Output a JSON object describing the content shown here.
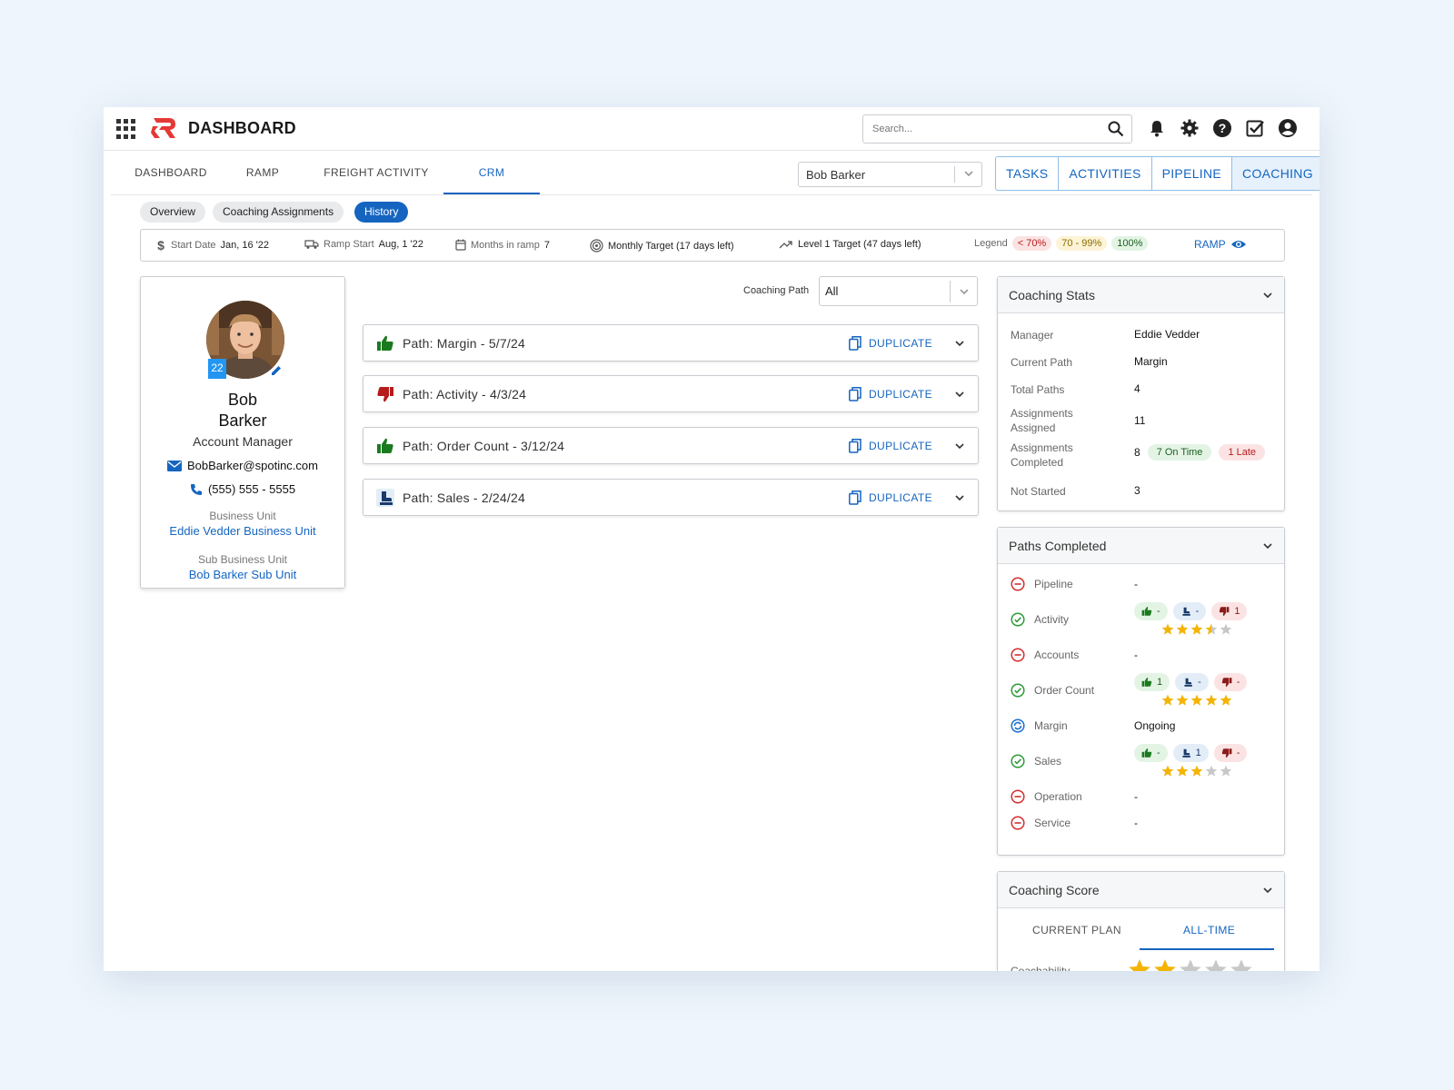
{
  "app": {
    "title": "DASHBOARD",
    "search_placeholder": "Search..."
  },
  "nav": {
    "tabs": [
      "DASHBOARD",
      "RAMP",
      "FREIGHT ACTIVITY",
      "CRM"
    ],
    "active": "CRM",
    "user_select": "Bob Barker",
    "actions": [
      "TASKS",
      "ACTIVITIES",
      "PIPELINE",
      "COACHING"
    ]
  },
  "chips": [
    "Overview",
    "Coaching Assignments",
    "History"
  ],
  "strip": {
    "start_date_label": "Start Date",
    "start_date": "Jan, 16 '22",
    "ramp_start_label": "Ramp Start",
    "ramp_start": "Aug, 1 '22",
    "months_label": "Months in ramp",
    "months": "7",
    "monthly_target": "Monthly Target (17 days left)",
    "level_target": "Level 1 Target (47 days left)",
    "legend_label": "Legend",
    "legend": [
      "< 70%",
      "70 - 99%",
      "100%"
    ],
    "ramp_link": "RAMP"
  },
  "profile": {
    "badge": "22",
    "first_name": "Bob",
    "last_name": "Barker",
    "role": "Account Manager",
    "email": "BobBarker@spotinc.com",
    "phone": "(555) 555 - 5555",
    "bu_label": "Business Unit",
    "bu": "Eddie Vedder Business Unit",
    "sbu_label": "Sub Business Unit",
    "sbu": "Bob Barker Sub Unit"
  },
  "coaching_path": {
    "label": "Coaching Path",
    "value": "All"
  },
  "paths": [
    {
      "title": "Path: Margin - 5/7/24",
      "status": "up"
    },
    {
      "title": "Path: Activity - 4/3/24",
      "status": "down"
    },
    {
      "title": "Path: Order Count - 3/12/24",
      "status": "up"
    },
    {
      "title": "Path: Sales - 2/24/24",
      "status": "neutral"
    }
  ],
  "duplicate_label": "DUPLICATE",
  "coaching_stats": {
    "title": "Coaching Stats",
    "rows": [
      {
        "label": "Manager",
        "value": "Eddie Vedder"
      },
      {
        "label": "Current Path",
        "value": "Margin"
      },
      {
        "label": "Total Paths",
        "value": "4"
      },
      {
        "label": "Assignments Assigned",
        "value": "11"
      },
      {
        "label": "Assignments Completed",
        "value": "8"
      },
      {
        "label": "Not Started",
        "value": "3"
      }
    ],
    "on_time": "7 On Time",
    "late": "1 Late"
  },
  "paths_completed": {
    "title": "Paths Completed",
    "rows": [
      {
        "label": "Pipeline",
        "state": "none",
        "value": "-"
      },
      {
        "label": "Activity",
        "state": "done",
        "votes": [
          "-",
          "-",
          "1"
        ],
        "rating": 3.5
      },
      {
        "label": "Accounts",
        "state": "none",
        "value": "-"
      },
      {
        "label": "Order Count",
        "state": "done",
        "votes": [
          "1",
          "-",
          "-"
        ],
        "rating": 5
      },
      {
        "label": "Margin",
        "state": "ongoing",
        "value": "Ongoing"
      },
      {
        "label": "Sales",
        "state": "done",
        "votes": [
          "-",
          "1",
          "-"
        ],
        "rating": 3
      },
      {
        "label": "Operation",
        "state": "none",
        "value": "-"
      },
      {
        "label": "Service",
        "state": "none",
        "value": "-"
      }
    ]
  },
  "coaching_score": {
    "title": "Coaching Score",
    "tabs": [
      "CURRENT PLAN",
      "ALL-TIME"
    ],
    "row_label": "Coachability",
    "rating": 2
  },
  "colors": {
    "accent": "#1565c0",
    "up": "#1b7a1f",
    "down": "#b71c1c",
    "star": "#f5b400"
  }
}
